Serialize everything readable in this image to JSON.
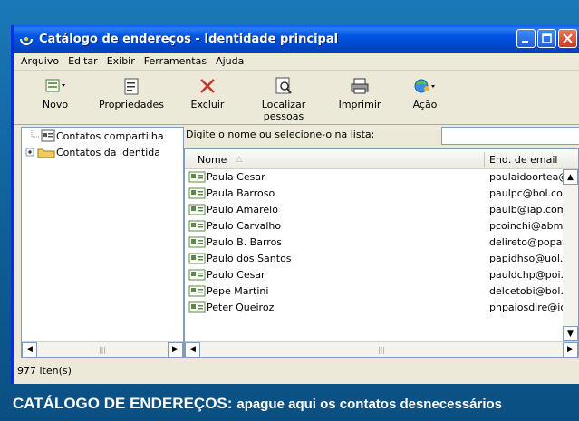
{
  "window": {
    "title": "Catálogo de endereços - Identidade principal"
  },
  "menu": [
    "Arquivo",
    "Editar",
    "Exibir",
    "Ferramentas",
    "Ajuda"
  ],
  "toolbar": {
    "new": "Novo",
    "properties": "Propriedades",
    "delete": "Excluir",
    "find_line1": "Localizar",
    "find_line2": "pessoas",
    "print": "Imprimir",
    "action": "Ação"
  },
  "tree": {
    "shared": "Contatos compartilha",
    "identity": "Contatos da Identida"
  },
  "search": {
    "label": "Digite o nome ou selecione-o na lista:"
  },
  "list": {
    "col_name": "Nome",
    "col_email": "End. de email",
    "rows": [
      {
        "name": "Paula Cesar",
        "email": "paulaidoortea@y"
      },
      {
        "name": "Paula Barroso",
        "email": "paulpc@bol.com"
      },
      {
        "name": "Paulo Amarelo",
        "email": "paulb@iap.com.b"
      },
      {
        "name": "Paulo Carvalho",
        "email": "pcoinchi@abm.cc"
      },
      {
        "name": "Paulo B. Barros",
        "email": "delireto@popati."
      },
      {
        "name": "Paulo dos Santos",
        "email": "papidhso@uol.cc"
      },
      {
        "name": "Paulo Cesar",
        "email": "pauldchp@poi.cc"
      },
      {
        "name": "Pepe Martini",
        "email": "delcetobi@bol.cc"
      },
      {
        "name": "Peter Queiroz",
        "email": "phpaiosdire@iopi"
      }
    ]
  },
  "status": "977 iten(s)",
  "caption": {
    "lead": "CATÁLOGO DE ENDEREÇOS:",
    "rest": "apague aqui os contatos desnecessários"
  },
  "colors": {
    "title_bar": "#0054e3",
    "frame": "#0f5c93",
    "window_bg": "#ece9d8"
  }
}
